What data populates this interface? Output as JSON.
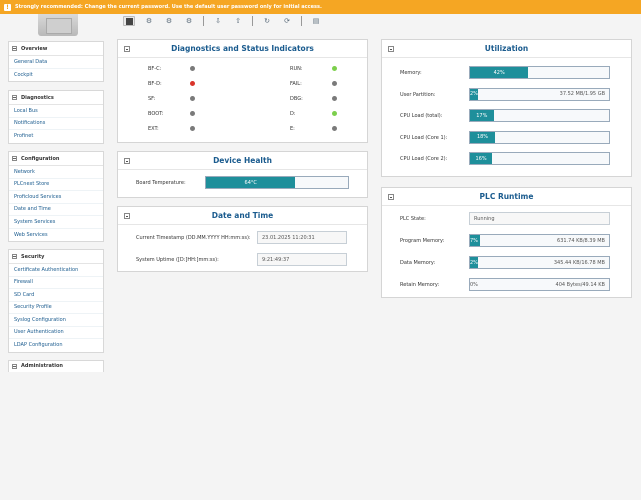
{
  "warning": {
    "text": "Strongly recommended: Change the current password. Use the default user password only for initial access."
  },
  "nav": {
    "overview": {
      "title": "Overview",
      "items": [
        "General Data",
        "Cockpit"
      ]
    },
    "diagnostics": {
      "title": "Diagnostics",
      "items": [
        "Local Bus",
        "Notifications",
        "Profinet"
      ]
    },
    "configuration": {
      "title": "Configuration",
      "items": [
        "Network",
        "PLCnext Store",
        "Proficloud Services",
        "Date and Time",
        "System Services",
        "Web Services"
      ]
    },
    "security": {
      "title": "Security",
      "items": [
        "Certificate Authentication",
        "Firewall",
        "SD Card",
        "Security Profile",
        "Syslog Configuration",
        "User Authentication",
        "LDAP Configuration"
      ]
    },
    "administration": {
      "title": "Administration"
    }
  },
  "diag": {
    "title": "Diagnostics and Status Indicators",
    "left": [
      {
        "label": "BF-C:",
        "color": "#7a7a7a"
      },
      {
        "label": "BF-D:",
        "color": "#d9342b"
      },
      {
        "label": "SF:",
        "color": "#7a7a7a"
      },
      {
        "label": "BOOT:",
        "color": "#7a7a7a"
      },
      {
        "label": "EXT:",
        "color": "#7a7a7a"
      }
    ],
    "right": [
      {
        "label": "RUN:",
        "color": "#7ccf4c"
      },
      {
        "label": "FAIL:",
        "color": "#7a7a7a"
      },
      {
        "label": "DBG:",
        "color": "#7a7a7a"
      },
      {
        "label": "D:",
        "color": "#7ccf4c"
      },
      {
        "label": "E:",
        "color": "#7a7a7a"
      }
    ]
  },
  "health": {
    "title": "Device Health",
    "temp_label": "Board Temperature:",
    "temp_value": "64°C",
    "temp_fraction": 0.63
  },
  "datetime": {
    "title": "Date and Time",
    "timestamp_label": "Current Timestamp (DD.MM.YYYY HH:mm:ss):",
    "timestamp_value": "23.01.2025  11:20:31",
    "uptime_label": "System Uptime ([D:]HH:]mm:ss):",
    "uptime_value": "9:21:49:37"
  },
  "utilization": {
    "title": "Utilization",
    "rows": [
      {
        "label": "Memory:",
        "pct": "42%",
        "fraction": 0.42,
        "detail": ""
      },
      {
        "label": "User Partition:",
        "pct": "2%",
        "fraction": 0.02,
        "detail": "37.52 MB/1.95 GB"
      },
      {
        "label": "CPU Load (total):",
        "pct": "17%",
        "fraction": 0.17,
        "detail": ""
      },
      {
        "label": "CPU Load (Core 1):",
        "pct": "18%",
        "fraction": 0.18,
        "detail": ""
      },
      {
        "label": "CPU Load (Core 2):",
        "pct": "16%",
        "fraction": 0.16,
        "detail": ""
      }
    ]
  },
  "runtime": {
    "title": "PLC Runtime",
    "state_label": "PLC State:",
    "state_value": "Running",
    "rows": [
      {
        "label": "Program Memory:",
        "pct": "7%",
        "fraction": 0.07,
        "detail": "631.74 KB/8.39 MB"
      },
      {
        "label": "Data Memory:",
        "pct": "2%",
        "fraction": 0.02,
        "detail": "345.44 KB/16.78 MB"
      },
      {
        "label": "Retain Memory:",
        "pct": "0%",
        "fraction": 0.0,
        "detail": "404 Bytes/49.14 KB"
      }
    ]
  },
  "colors": {
    "accent": "#1a5b8e",
    "bar": "#1e8f9b",
    "warning": "#f5a623"
  }
}
